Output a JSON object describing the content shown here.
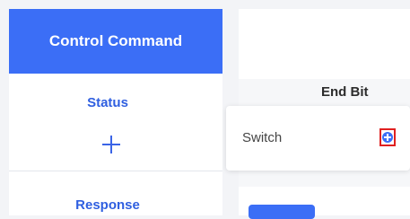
{
  "sidebar": {
    "header": "Control Command",
    "status": "Status",
    "add_icon": "plus-icon",
    "response": "Response"
  },
  "table": {
    "column_header": "End Bit",
    "row_label": "Switch",
    "row_action_icon": "add-circle-icon"
  },
  "colors": {
    "accent": "#3b6ef6",
    "highlight": "#e02020"
  }
}
